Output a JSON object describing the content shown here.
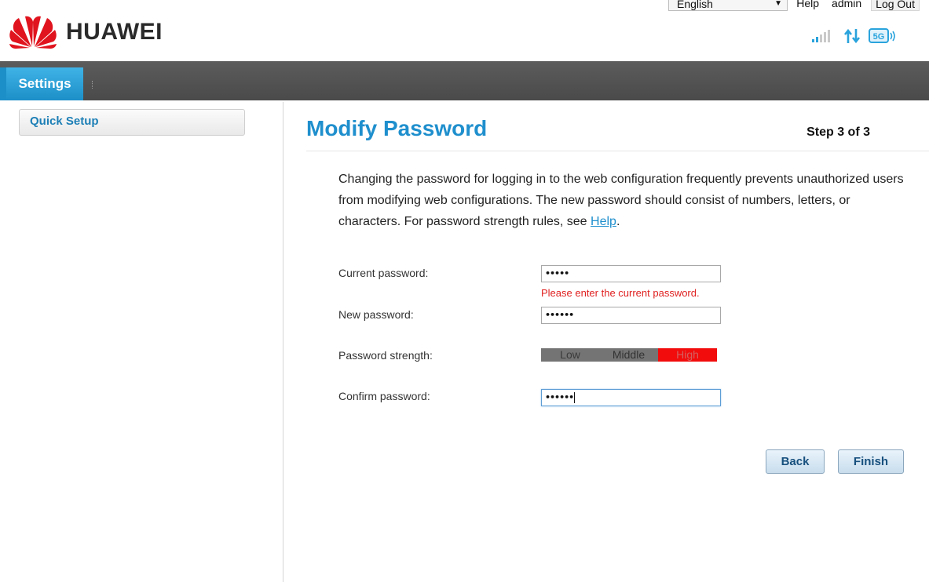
{
  "header": {
    "brand": "HUAWEI",
    "language": "English",
    "links": [
      "Help",
      "admin",
      "Log Out"
    ],
    "status_icons": [
      "signal-strength-icon",
      "data-transfer-icon",
      "5g-network-icon"
    ],
    "network_badge": "5G"
  },
  "nav": {
    "tab": "Settings"
  },
  "sidebar": {
    "items": [
      "Quick Setup"
    ]
  },
  "main": {
    "title": "Modify Password",
    "step": "Step 3 of 3",
    "description": "Changing the password for logging in to the web configuration frequently prevents unauthorized users from modifying web configurations. The new password should consist of numbers, letters, or characters. For password strength rules, see",
    "help_link": "Help",
    "current_password": {
      "label": "Current password:",
      "value": "•••••"
    },
    "error": "Please enter the current password.",
    "new_password": {
      "label": "New password:",
      "value": "••••••"
    },
    "strength": {
      "label": "Password strength:",
      "levels": [
        "Low",
        "Middle",
        "High"
      ],
      "active": "High",
      "colors": {
        "inactive": "#747474",
        "active": "#f20c0c"
      }
    },
    "confirm_password": {
      "label": "Confirm password:",
      "value": "••••••"
    },
    "buttons": {
      "back": "Back",
      "finish": "Finish"
    }
  },
  "colors": {
    "accent": "#1f8fcd",
    "error": "#e02020",
    "navbar": "#4a4a4a"
  }
}
